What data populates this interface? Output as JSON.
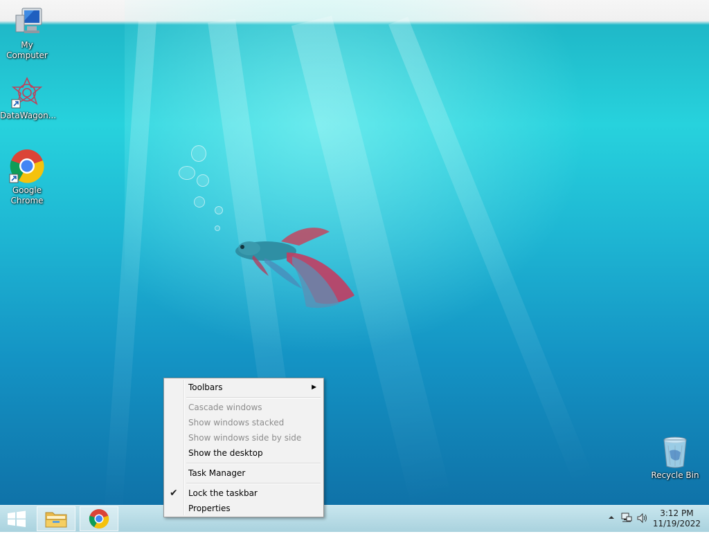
{
  "desktop": {
    "icons": [
      {
        "label": "My Computer",
        "icon": "computer-icon"
      },
      {
        "label": "DataWagon...",
        "icon": "datawagon-icon"
      },
      {
        "label": "Google Chrome",
        "icon": "chrome-icon"
      },
      {
        "label": "Recycle Bin",
        "icon": "recycle-bin-icon"
      }
    ]
  },
  "context_menu": {
    "items": [
      {
        "label": "Toolbars",
        "enabled": true,
        "submenu": true
      },
      {
        "label": "Cascade windows",
        "enabled": false
      },
      {
        "label": "Show windows stacked",
        "enabled": false
      },
      {
        "label": "Show windows side by side",
        "enabled": false
      },
      {
        "label": "Show the desktop",
        "enabled": true
      },
      {
        "label": "Task Manager",
        "enabled": true
      },
      {
        "label": "Lock the taskbar",
        "enabled": true,
        "checked": true
      },
      {
        "label": "Properties",
        "enabled": true
      }
    ]
  },
  "taskbar": {
    "pinned": [
      {
        "name": "File Explorer",
        "icon": "file-explorer-icon"
      },
      {
        "name": "Google Chrome",
        "icon": "chrome-icon"
      }
    ],
    "tray": {
      "icons": [
        "chevron-up-icon",
        "network-icon",
        "volume-icon"
      ],
      "time": "3:12 PM",
      "date": "11/19/2022"
    }
  },
  "colors": {
    "water_top": "#27d2dd",
    "water_bottom": "#0f72a8",
    "taskbar": "#b9dde7",
    "menu_bg": "#f2f2f2"
  }
}
